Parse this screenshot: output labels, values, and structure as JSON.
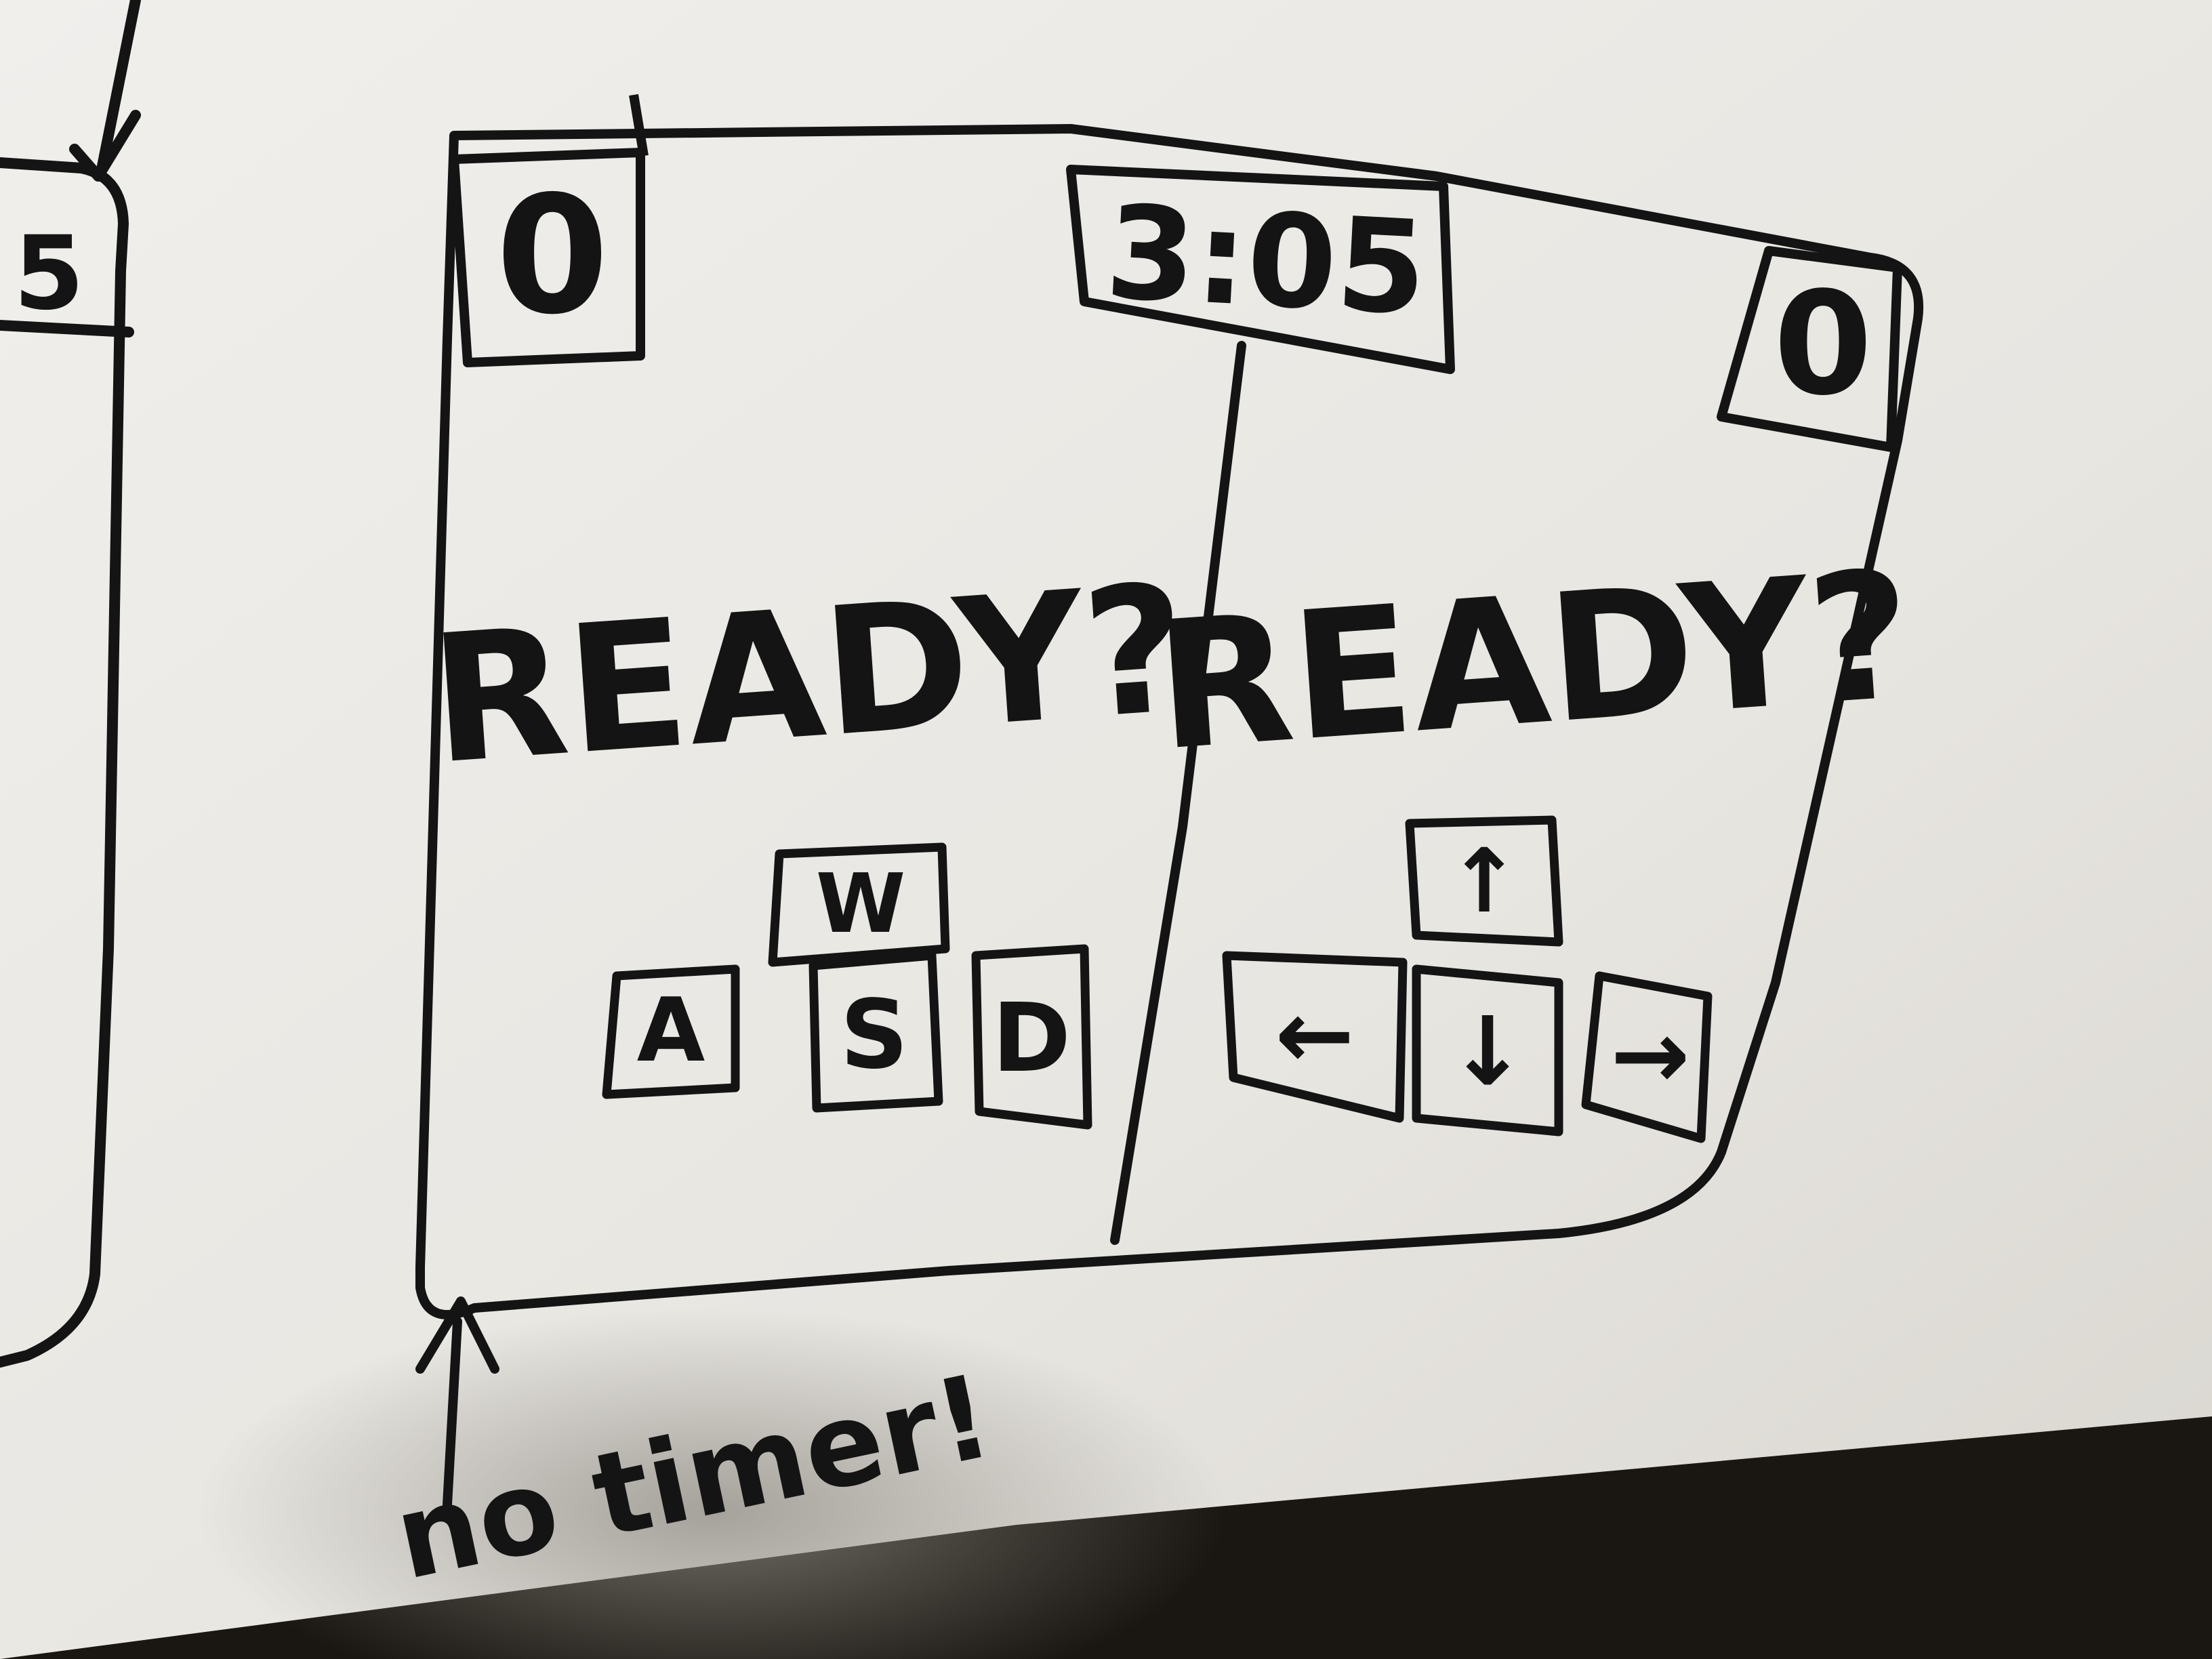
{
  "sketch": {
    "left_panel_partial": {
      "score_fragment": "5"
    },
    "screen": {
      "timer": "3:05",
      "player1": {
        "score": "0",
        "prompt": "READY?",
        "keys": {
          "up": "W",
          "left": "A",
          "down": "S",
          "right": "D"
        }
      },
      "player2": {
        "score": "0",
        "prompt": "READY?",
        "keys": {
          "up": "↑",
          "left": "←",
          "down": "↓",
          "right": "→"
        }
      }
    },
    "annotation": {
      "text": "no timer!"
    }
  },
  "colors": {
    "board": "#eceae6",
    "board_shadow": "#c9c6c0",
    "background": "#1a1712",
    "ink": "#141414"
  }
}
